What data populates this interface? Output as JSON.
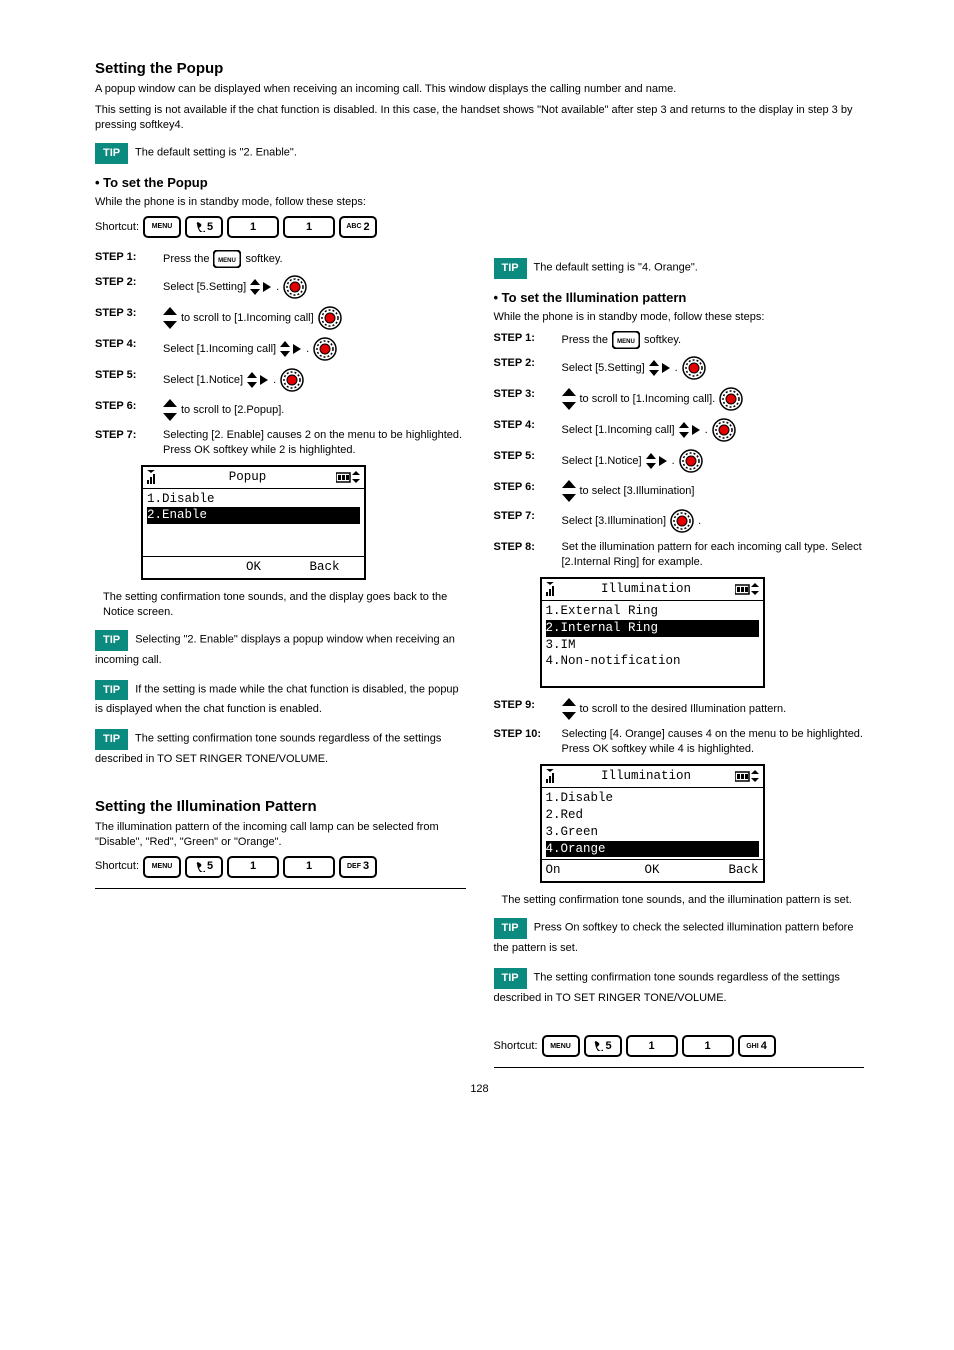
{
  "title": "Setting the Popup",
  "title_intro_1": "A popup window can be displayed when receiving an incoming call. This window displays the calling number and name.",
  "title_intro_2": "This setting is not available if the chat function is disabled. In this case, the handset shows \"Not available\" after step 3 and returns to the display in step 3 by pressing softkey4.",
  "tip": "TIP",
  "default_popup": "The default setting is \"2. Enable\".",
  "shortcut_label": "Shortcut:",
  "popup_section": {
    "subtitle": "• To set the Popup",
    "intro": "While the phone is in standby mode, follow these steps:",
    "steps": [
      {
        "label": "STEP 1:",
        "text_a": "Press the ",
        "text_b": " softkey."
      },
      {
        "label": "STEP 2:",
        "pre": "Select [5.Setting] ",
        "post": "."
      },
      {
        "label": "STEP 3:",
        "pre": "",
        "post": " to scroll to [1.Incoming call]"
      },
      {
        "label": "STEP 4:",
        "pre": "Select [1.Incoming call] ",
        "post": "."
      },
      {
        "label": "STEP 5:",
        "pre": "Select [1.Notice] ",
        "post": "."
      },
      {
        "label": "STEP 6:",
        "pre": "",
        "post": " to scroll to [2.Popup]."
      },
      {
        "label": "STEP 7:",
        "text": "Selecting [2. Enable] causes 2 on the menu to be highlighted. Press OK softkey while 2 is highlighted."
      }
    ],
    "confirm_intro": "The setting confirmation tone sounds, and the display goes back to the Notice screen.",
    "tip_enable": "Selecting \"2. Enable\" displays a popup window when receiving an incoming call.",
    "tip_chat": "If the setting is made while the chat function is disabled, the popup is displayed when the chat function is enabled.",
    "tip_tone": "The setting confirmation tone sounds regardless of the settings described in TO SET RINGER TONE/VOLUME."
  },
  "popup_screen": {
    "title": "Popup",
    "items": [
      "1.Disable",
      "2.Enable"
    ],
    "highlight_index": 1,
    "ok": "OK",
    "back": "Back"
  },
  "illum_title": "Setting the Illumination Pattern",
  "illum_intro": "The illumination pattern of the incoming call lamp can be selected from \"Disable\", \"Red\", \"Green\" or \"Orange\".",
  "default_illum": "The default setting is \"4. Orange\".",
  "illum_section": {
    "subtitle": "• To set the Illumination pattern",
    "intro": "While the phone is in standby mode, follow these steps:",
    "steps": [
      {
        "label": "STEP 1:",
        "text_a": "Press the ",
        "text_b": " softkey."
      },
      {
        "label": "STEP 2:",
        "pre": "Select [5.Setting] ",
        "post": "."
      },
      {
        "label": "STEP 3:",
        "pre": "",
        "post": " to scroll to [1.Incoming call]."
      },
      {
        "label": "STEP 4:",
        "pre": "Select [1.Incoming call] ",
        "post": "."
      },
      {
        "label": "STEP 5:",
        "pre": "Select [1.Notice] ",
        "post": "."
      },
      {
        "label": "STEP 6:",
        "pre": "",
        "post": " to select [3.Illumination]"
      },
      {
        "label": "STEP 7:",
        "pre": "Select [3.Illumination] ",
        "post": "."
      },
      {
        "label": "STEP 8:",
        "text": "Set the illumination pattern for each incoming call type. Select [2.Internal Ring] for example."
      },
      {
        "label": "STEP 9:",
        "pre": "",
        "post": " to scroll to the desired Illumination pattern."
      },
      {
        "label": "STEP 10:",
        "text": "Selecting [4. Orange] causes 4 on the menu to be highlighted. Press OK softkey while 4 is highlighted."
      }
    ],
    "confirm_intro": "The setting confirmation tone sounds, and the illumination pattern is set.",
    "tip_on": "Press On softkey to check the selected illumination pattern before the pattern is set.",
    "tip_tone": "The setting confirmation tone sounds regardless of the settings described in TO SET RINGER TONE/VOLUME."
  },
  "illum_screen1": {
    "title": "Illumination",
    "items": [
      "1.External Ring",
      "2.Internal Ring",
      "3.IM",
      "4.Non-notification"
    ],
    "highlight_index": 1
  },
  "illum_screen2": {
    "title": "Illumination",
    "items": [
      "1.Disable",
      "2.Red",
      "3.Green",
      "4.Orange"
    ],
    "highlight_index": 3,
    "on": "On",
    "ok": "OK",
    "back": "Back"
  },
  "page_number": "128"
}
